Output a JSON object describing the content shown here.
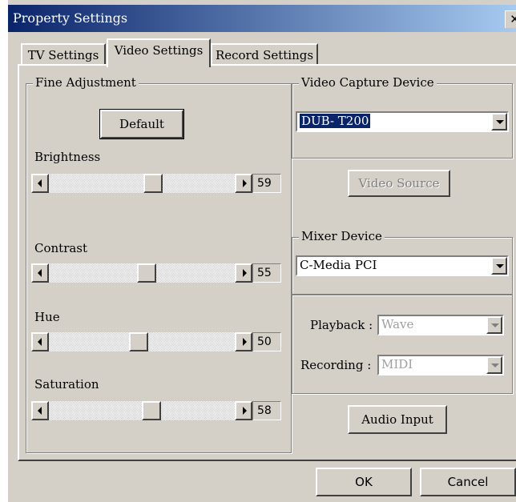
{
  "window": {
    "title": "Property Settings",
    "close_glyph": "✕"
  },
  "tabs": [
    {
      "label": "TV Settings"
    },
    {
      "label": "Video Settings",
      "active": true
    },
    {
      "label": "Record Settings"
    }
  ],
  "fine_adjustment": {
    "title": "Fine Adjustment",
    "default_button": "Default",
    "sliders": [
      {
        "label": "Brightness",
        "value": "59"
      },
      {
        "label": "Contrast",
        "value": "55"
      },
      {
        "label": "Hue",
        "value": "50"
      },
      {
        "label": "Saturation",
        "value": "58"
      }
    ]
  },
  "video_capture": {
    "title": "Video Capture Device",
    "device": "DUB- T200",
    "source_button": "Video Source"
  },
  "mixer": {
    "title": "Mixer Device",
    "device": "C-Media PCI",
    "playback_label": "Playback :",
    "playback_value": "Wave",
    "recording_label": "Recording :",
    "recording_value": "MIDI",
    "audio_input_button": "Audio Input"
  },
  "footer": {
    "ok": "OK",
    "cancel": "Cancel"
  },
  "colors": {
    "face": "#d4d0c8",
    "title_start": "#0a246a",
    "title_end": "#a6caf0",
    "selection": "#0a246a"
  }
}
